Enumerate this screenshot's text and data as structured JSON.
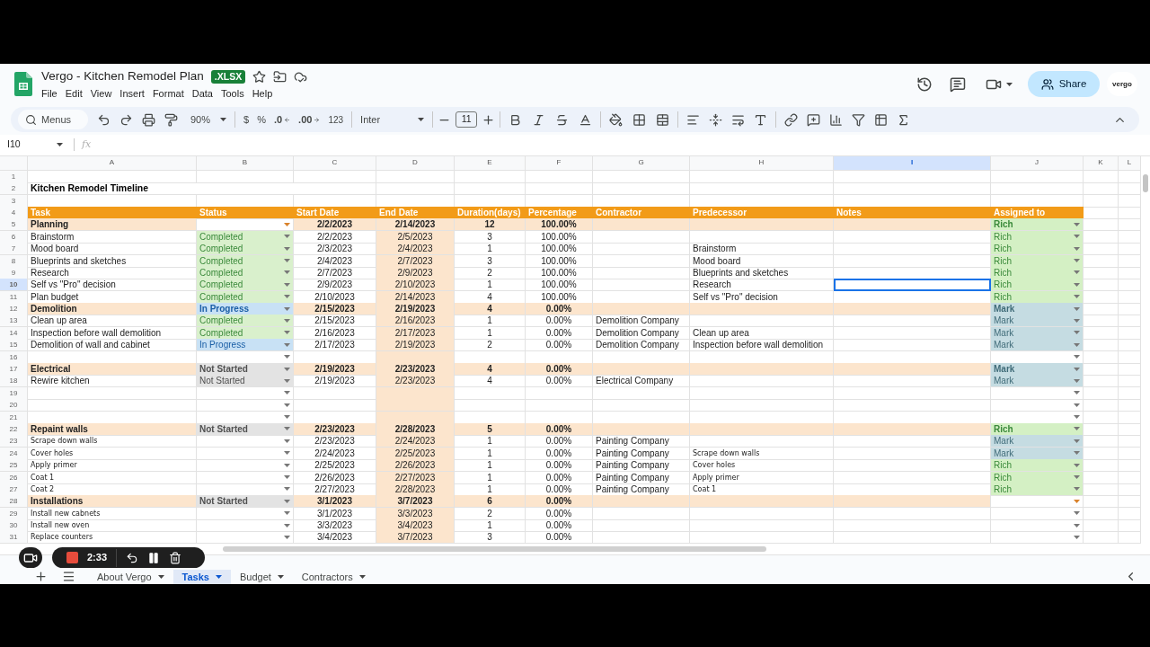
{
  "window": {
    "title": "Vergo - Kitchen Remodel Plan",
    "badge": ".XLSX",
    "account_logo": "vergo",
    "share": "Share"
  },
  "menu": [
    "File",
    "Edit",
    "View",
    "Insert",
    "Format",
    "Data",
    "Tools",
    "Help"
  ],
  "toolbar": {
    "search_placeholder": "Menus",
    "zoom": "90%",
    "currency": "$",
    "percent": "%",
    "decrease_decimals": ".0",
    "increase_decimals": ".00",
    "number_format": "123",
    "font": "Inter",
    "font_size": "11"
  },
  "formula_bar": {
    "name_box": "I10",
    "fx": "fx"
  },
  "table": {
    "columns": [
      {
        "letter": "A",
        "selected": false
      },
      {
        "letter": "B",
        "selected": false
      },
      {
        "letter": "C",
        "selected": false
      },
      {
        "letter": "D",
        "selected": false
      },
      {
        "letter": "E",
        "selected": false
      },
      {
        "letter": "F",
        "selected": false
      },
      {
        "letter": "G",
        "selected": false
      },
      {
        "letter": "H",
        "selected": false
      },
      {
        "letter": "I",
        "selected": true
      },
      {
        "letter": "J",
        "selected": false
      },
      {
        "letter": "K",
        "selected": false
      },
      {
        "letter": "L",
        "selected": false
      }
    ],
    "top_rows": [
      {
        "n": "1"
      },
      {
        "n": "2",
        "title": "Kitchen Remodel Timeline"
      },
      {
        "n": "3"
      }
    ],
    "header": {
      "n": "4",
      "cells": [
        "Task",
        "Status",
        "Start Date",
        "End Date",
        "Duration(days)",
        "Percentage",
        "Contractor",
        "Predecessor",
        "Notes",
        "Assigned to"
      ]
    },
    "rows": [
      {
        "n": "5",
        "kind": "group",
        "selected": false,
        "task": "Planning",
        "status": {
          "kind": "none"
        },
        "start": "2/2/2023",
        "end": "2/14/2023",
        "duration": "12",
        "percentage": "100.00%",
        "assigned": {
          "text": "Rich",
          "kind": "rich"
        }
      },
      {
        "n": "6",
        "kind": "task",
        "selected": false,
        "task": "Brainstorm",
        "status": {
          "text": "Completed",
          "kind": "completed"
        },
        "start": "2/2/2023",
        "end": "2/5/2023",
        "duration": "3",
        "percentage": "100.00%",
        "assigned": {
          "text": "Rich",
          "kind": "rich"
        }
      },
      {
        "n": "7",
        "kind": "task",
        "selected": false,
        "task": "Mood board",
        "status": {
          "text": "Completed",
          "kind": "completed"
        },
        "start": "2/3/2023",
        "end": "2/4/2023",
        "duration": "1",
        "percentage": "100.00%",
        "predecessor": "Brainstorm",
        "assigned": {
          "text": "Rich",
          "kind": "rich"
        }
      },
      {
        "n": "8",
        "kind": "task",
        "selected": false,
        "task": "Blueprints and sketches",
        "status": {
          "text": "Completed",
          "kind": "completed"
        },
        "start": "2/4/2023",
        "end": "2/7/2023",
        "duration": "3",
        "percentage": "100.00%",
        "predecessor": "Mood board",
        "assigned": {
          "text": "Rich",
          "kind": "rich"
        }
      },
      {
        "n": "9",
        "kind": "task",
        "selected": false,
        "task": "Research",
        "status": {
          "text": "Completed",
          "kind": "completed"
        },
        "start": "2/7/2023",
        "end": "2/9/2023",
        "duration": "2",
        "percentage": "100.00%",
        "predecessor": "Blueprints and sketches",
        "assigned": {
          "text": "Rich",
          "kind": "rich"
        }
      },
      {
        "n": "10",
        "kind": "task",
        "selected": true,
        "task": "Self vs \"Pro\" decision",
        "status": {
          "text": "Completed",
          "kind": "completed"
        },
        "start": "2/9/2023",
        "end": "2/10/2023",
        "duration": "1",
        "percentage": "100.00%",
        "predecessor": "Research",
        "assigned": {
          "text": "Rich",
          "kind": "rich"
        }
      },
      {
        "n": "11",
        "kind": "task",
        "selected": false,
        "task": "Plan budget",
        "status": {
          "text": "Completed",
          "kind": "completed"
        },
        "start": "2/10/2023",
        "end": "2/14/2023",
        "duration": "4",
        "percentage": "100.00%",
        "predecessor": "Self vs \"Pro\" decision",
        "assigned": {
          "text": "Rich",
          "kind": "rich"
        }
      },
      {
        "n": "12",
        "kind": "group",
        "selected": false,
        "task": "Demolition",
        "status": {
          "text": "In Progress",
          "kind": "in_progress"
        },
        "start": "2/15/2023",
        "end": "2/19/2023",
        "duration": "4",
        "percentage": "0.00%",
        "assigned": {
          "text": "Mark",
          "kind": "mark"
        }
      },
      {
        "n": "13",
        "kind": "task",
        "selected": false,
        "task": "Clean up area",
        "status": {
          "text": "Completed",
          "kind": "completed"
        },
        "start": "2/15/2023",
        "end": "2/16/2023",
        "duration": "1",
        "percentage": "0.00%",
        "contractor": "Demolition Company",
        "assigned": {
          "text": "Mark",
          "kind": "mark"
        }
      },
      {
        "n": "14",
        "kind": "task",
        "selected": false,
        "task": "Inspection before wall demolition",
        "status": {
          "text": "Completed",
          "kind": "completed"
        },
        "start": "2/16/2023",
        "end": "2/17/2023",
        "duration": "1",
        "percentage": "0.00%",
        "contractor": "Demolition Company",
        "predecessor": "Clean up area",
        "assigned": {
          "text": "Mark",
          "kind": "mark"
        }
      },
      {
        "n": "15",
        "kind": "task",
        "selected": false,
        "task": "Demolition of wall and cabinet",
        "status": {
          "text": "In Progress",
          "kind": "in_progress"
        },
        "start": "2/17/2023",
        "end": "2/19/2023",
        "duration": "2",
        "percentage": "0.00%",
        "contractor": "Demolition Company",
        "predecessor": "Inspection before wall demolition",
        "assigned": {
          "text": "Mark",
          "kind": "mark"
        }
      },
      {
        "n": "16",
        "kind": "blank",
        "selected": false,
        "status": {
          "kind": "none"
        },
        "assigned": {
          "kind": "none"
        }
      },
      {
        "n": "17",
        "kind": "group",
        "selected": false,
        "task": "Electrical",
        "status": {
          "text": "Not Started",
          "kind": "not_started"
        },
        "start": "2/19/2023",
        "end": "2/23/2023",
        "duration": "4",
        "percentage": "0.00%",
        "assigned": {
          "text": "Mark",
          "kind": "mark"
        }
      },
      {
        "n": "18",
        "kind": "task",
        "selected": false,
        "task": "Rewire kitchen",
        "status": {
          "text": "Not Started",
          "kind": "not_started"
        },
        "start": "2/19/2023",
        "end": "2/23/2023",
        "duration": "4",
        "percentage": "0.00%",
        "contractor": "Electrical Company",
        "assigned": {
          "text": "Mark",
          "kind": "mark"
        }
      },
      {
        "n": "19",
        "kind": "blank",
        "selected": false,
        "status": {
          "kind": "none"
        },
        "assigned": {
          "kind": "none"
        }
      },
      {
        "n": "20",
        "kind": "blank",
        "selected": false,
        "status": {
          "kind": "none"
        },
        "assigned": {
          "kind": "none"
        }
      },
      {
        "n": "21",
        "kind": "blank",
        "selected": false,
        "status": {
          "kind": "none"
        },
        "assigned": {
          "kind": "none"
        }
      },
      {
        "n": "22",
        "kind": "group",
        "selected": false,
        "task": "Repaint walls",
        "status": {
          "text": "Not Started",
          "kind": "not_started"
        },
        "start": "2/23/2023",
        "end": "2/28/2023",
        "duration": "5",
        "percentage": "0.00%",
        "assigned": {
          "text": "Rich",
          "kind": "rich"
        }
      },
      {
        "n": "23",
        "kind": "task_small",
        "selected": false,
        "task": "Scrape down walls",
        "status": {
          "kind": "none"
        },
        "start": "2/23/2023",
        "end": "2/24/2023",
        "duration": "1",
        "percentage": "0.00%",
        "contractor": "Painting Company",
        "assigned": {
          "text": "Mark",
          "kind": "mark"
        }
      },
      {
        "n": "24",
        "kind": "task_small",
        "selected": false,
        "task": "Cover holes",
        "status": {
          "kind": "none"
        },
        "start": "2/24/2023",
        "end": "2/25/2023",
        "duration": "1",
        "percentage": "0.00%",
        "contractor": "Painting Company",
        "predecessor": "Scrape down walls",
        "assigned": {
          "text": "Mark",
          "kind": "mark"
        }
      },
      {
        "n": "25",
        "kind": "task_small",
        "selected": false,
        "task": "Apply primer",
        "status": {
          "kind": "none"
        },
        "start": "2/25/2023",
        "end": "2/26/2023",
        "duration": "1",
        "percentage": "0.00%",
        "contractor": "Painting Company",
        "predecessor": "Cover holes",
        "assigned": {
          "text": "Rich",
          "kind": "rich"
        }
      },
      {
        "n": "26",
        "kind": "task_small",
        "selected": false,
        "task": "Coat 1",
        "status": {
          "kind": "none"
        },
        "start": "2/26/2023",
        "end": "2/27/2023",
        "duration": "1",
        "percentage": "0.00%",
        "contractor": "Painting Company",
        "predecessor": "Apply primer",
        "assigned": {
          "text": "Rich",
          "kind": "rich"
        }
      },
      {
        "n": "27",
        "kind": "task_small",
        "selected": false,
        "task": "Coat 2",
        "status": {
          "kind": "none"
        },
        "start": "2/27/2023",
        "end": "2/28/2023",
        "duration": "1",
        "percentage": "0.00%",
        "contractor": "Painting Company",
        "predecessor": "Coat 1",
        "assigned": {
          "text": "Rich",
          "kind": "rich"
        }
      },
      {
        "n": "28",
        "kind": "group",
        "selected": false,
        "task": "Installations",
        "status": {
          "text": "Not Started",
          "kind": "not_started"
        },
        "start": "3/1/2023",
        "end": "3/7/2023",
        "duration": "6",
        "percentage": "0.00%",
        "assigned": {
          "kind": "none"
        }
      },
      {
        "n": "29",
        "kind": "task_small",
        "selected": false,
        "task": "Install new cabnets",
        "status": {
          "kind": "none"
        },
        "start": "3/1/2023",
        "end": "3/3/2023",
        "duration": "2",
        "percentage": "0.00%",
        "assigned": {
          "kind": "none"
        }
      },
      {
        "n": "30",
        "kind": "task_small",
        "selected": false,
        "task": "Install new oven",
        "status": {
          "kind": "none"
        },
        "start": "3/3/2023",
        "end": "3/4/2023",
        "duration": "1",
        "percentage": "0.00%",
        "assigned": {
          "kind": "none"
        }
      },
      {
        "n": "31",
        "kind": "task_small",
        "selected": false,
        "task": "Replace counters",
        "status": {
          "kind": "none"
        },
        "start": "3/4/2023",
        "end": "3/7/2023",
        "duration": "3",
        "percentage": "0.00%",
        "assigned": {
          "kind": "none"
        }
      }
    ]
  },
  "sheet_tabs": [
    {
      "label": "About Vergo",
      "selected": false
    },
    {
      "label": "Tasks",
      "selected": true
    },
    {
      "label": "Budget",
      "selected": false
    },
    {
      "label": "Contractors",
      "selected": false
    }
  ],
  "recorder": {
    "time": "2:33"
  }
}
